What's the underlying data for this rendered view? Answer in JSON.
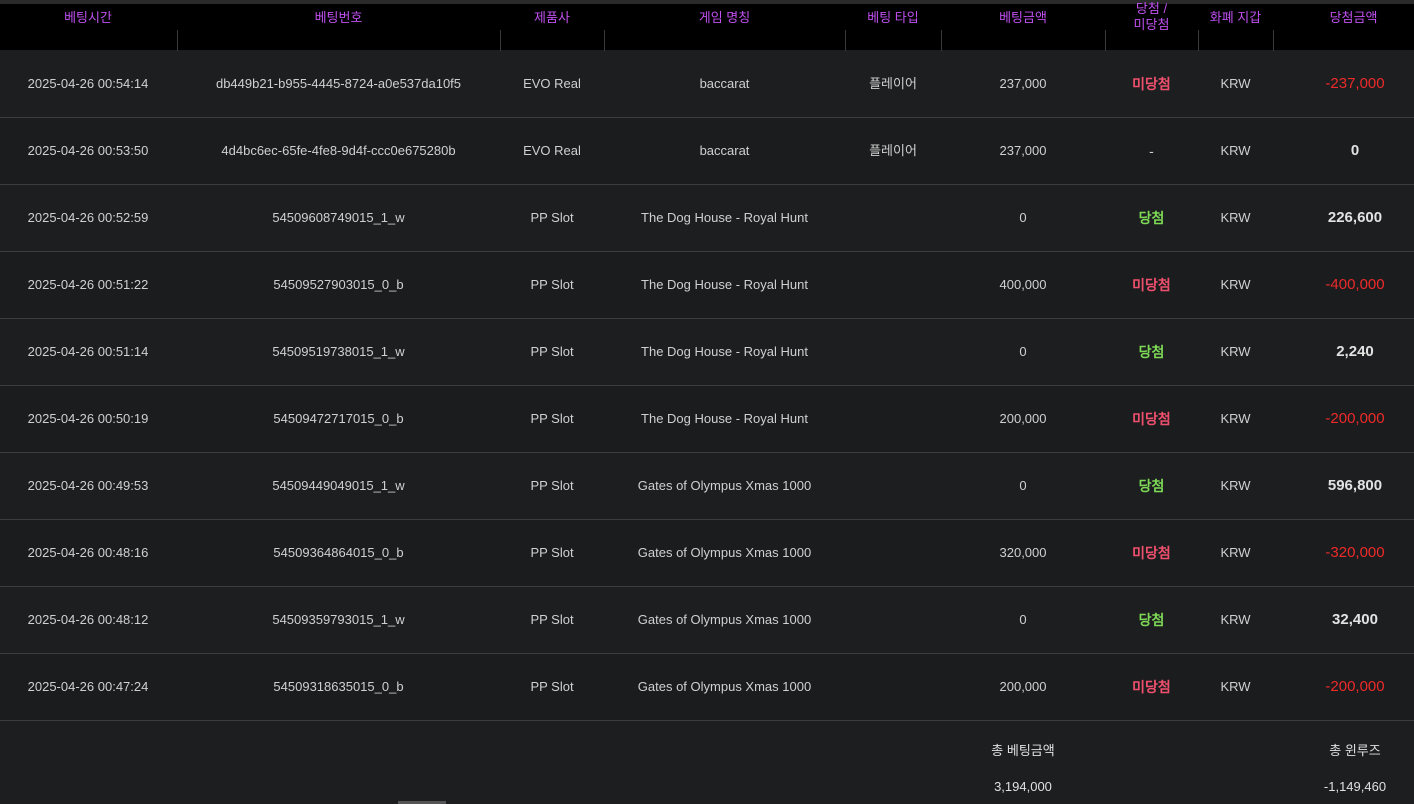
{
  "headers": {
    "time": "베팅시간",
    "bet_id": "베팅번호",
    "vendor": "제품사",
    "game": "게임 명칭",
    "bet_type": "베팅 타입",
    "bet_amount": "베팅금액",
    "result_line1": "당첨 /",
    "result_line2": "미당첨",
    "currency": "화폐 지갑",
    "win_amount": "당첨금액"
  },
  "rows": [
    {
      "time": "2025-04-26 00:54:14",
      "bet_id": "db449b21-b955-4445-8724-a0e537da10f5",
      "vendor": "EVO Real",
      "game": "baccarat",
      "bet_type": "플레이어",
      "bet_amount": "237,000",
      "result": "미당첨",
      "result_kind": "lose",
      "currency": "KRW",
      "win_amount": "-237,000",
      "win_kind": "neg"
    },
    {
      "time": "2025-04-26 00:53:50",
      "bet_id": "4d4bc6ec-65fe-4fe8-9d4f-ccc0e675280b",
      "vendor": "EVO Real",
      "game": "baccarat",
      "bet_type": "플레이어",
      "bet_amount": "237,000",
      "result": "-",
      "result_kind": "none",
      "currency": "KRW",
      "win_amount": "0",
      "win_kind": "pos"
    },
    {
      "time": "2025-04-26 00:52:59",
      "bet_id": "54509608749015_1_w",
      "vendor": "PP Slot",
      "game": "The Dog House - Royal Hunt",
      "bet_type": "",
      "bet_amount": "0",
      "result": "당첨",
      "result_kind": "win",
      "currency": "KRW",
      "win_amount": "226,600",
      "win_kind": "pos"
    },
    {
      "time": "2025-04-26 00:51:22",
      "bet_id": "54509527903015_0_b",
      "vendor": "PP Slot",
      "game": "The Dog House - Royal Hunt",
      "bet_type": "",
      "bet_amount": "400,000",
      "result": "미당첨",
      "result_kind": "lose",
      "currency": "KRW",
      "win_amount": "-400,000",
      "win_kind": "neg"
    },
    {
      "time": "2025-04-26 00:51:14",
      "bet_id": "54509519738015_1_w",
      "vendor": "PP Slot",
      "game": "The Dog House - Royal Hunt",
      "bet_type": "",
      "bet_amount": "0",
      "result": "당첨",
      "result_kind": "win",
      "currency": "KRW",
      "win_amount": "2,240",
      "win_kind": "pos"
    },
    {
      "time": "2025-04-26 00:50:19",
      "bet_id": "54509472717015_0_b",
      "vendor": "PP Slot",
      "game": "The Dog House - Royal Hunt",
      "bet_type": "",
      "bet_amount": "200,000",
      "result": "미당첨",
      "result_kind": "lose",
      "currency": "KRW",
      "win_amount": "-200,000",
      "win_kind": "neg"
    },
    {
      "time": "2025-04-26 00:49:53",
      "bet_id": "54509449049015_1_w",
      "vendor": "PP Slot",
      "game": "Gates of Olympus Xmas 1000",
      "bet_type": "",
      "bet_amount": "0",
      "result": "당첨",
      "result_kind": "win",
      "currency": "KRW",
      "win_amount": "596,800",
      "win_kind": "pos"
    },
    {
      "time": "2025-04-26 00:48:16",
      "bet_id": "54509364864015_0_b",
      "vendor": "PP Slot",
      "game": "Gates of Olympus Xmas 1000",
      "bet_type": "",
      "bet_amount": "320,000",
      "result": "미당첨",
      "result_kind": "lose",
      "currency": "KRW",
      "win_amount": "-320,000",
      "win_kind": "neg"
    },
    {
      "time": "2025-04-26 00:48:12",
      "bet_id": "54509359793015_1_w",
      "vendor": "PP Slot",
      "game": "Gates of Olympus Xmas 1000",
      "bet_type": "",
      "bet_amount": "0",
      "result": "당첨",
      "result_kind": "win",
      "currency": "KRW",
      "win_amount": "32,400",
      "win_kind": "pos"
    },
    {
      "time": "2025-04-26 00:47:24",
      "bet_id": "54509318635015_0_b",
      "vendor": "PP Slot",
      "game": "Gates of Olympus Xmas 1000",
      "bet_type": "",
      "bet_amount": "200,000",
      "result": "미당첨",
      "result_kind": "lose",
      "currency": "KRW",
      "win_amount": "-200,000",
      "win_kind": "neg"
    }
  ],
  "summary": {
    "total_bet_label": "총 베팅금액",
    "total_bet_value": "3,194,000",
    "total_winloss_label": "총 윈루즈",
    "total_winloss_value": "-1,149,460"
  },
  "colors": {
    "header_text": "#c050f0",
    "win": "#7ed957",
    "lose": "#f0506e",
    "negative_amount": "#ee2a2a"
  }
}
